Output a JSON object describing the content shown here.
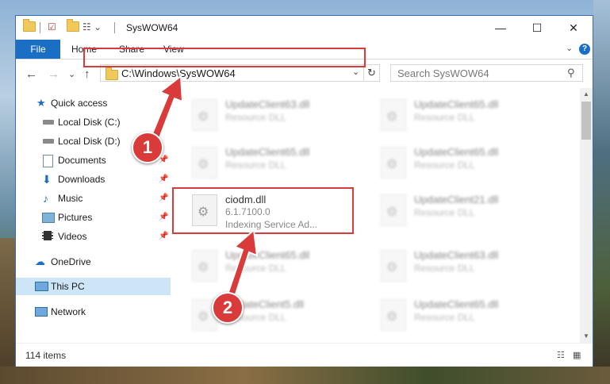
{
  "window": {
    "title": "SysWOW64",
    "controls": {
      "minimize": "—",
      "maximize": "☐",
      "close": "✕"
    }
  },
  "ribbon": {
    "tabs": [
      "File",
      "Home",
      "Share",
      "View"
    ],
    "help": "?",
    "expand": "⌄"
  },
  "nav": {
    "back": "←",
    "forward": "→",
    "recent": "⌄",
    "up": "↑",
    "address": "C:\\Windows\\SysWOW64",
    "address_dropdown": "⌄",
    "refresh": "↻",
    "search_placeholder": "Search SysWOW64"
  },
  "sidebar": {
    "items": [
      {
        "label": "Quick access",
        "icon": "star-icon",
        "pinned": false
      },
      {
        "label": "Local Disk (C:)",
        "icon": "drive-icon",
        "pinned": false
      },
      {
        "label": "Local Disk (D:)",
        "icon": "drive-icon",
        "pinned": false
      },
      {
        "label": "Documents",
        "icon": "documents-icon",
        "pinned": true
      },
      {
        "label": "Downloads",
        "icon": "downloads-icon",
        "pinned": true
      },
      {
        "label": "Music",
        "icon": "music-icon",
        "pinned": true
      },
      {
        "label": "Pictures",
        "icon": "pictures-icon",
        "pinned": true
      },
      {
        "label": "Videos",
        "icon": "videos-icon",
        "pinned": true
      },
      {
        "label": "OneDrive",
        "icon": "cloud-icon",
        "pinned": false
      },
      {
        "label": "This PC",
        "icon": "computer-icon",
        "pinned": false,
        "selected": true
      },
      {
        "label": "Network",
        "icon": "network-icon",
        "pinned": false
      }
    ]
  },
  "files": [
    {
      "name": "UpdateClient63.dll",
      "type": "Resource DLL",
      "blurred": true
    },
    {
      "name": "UpdateClient65.dll",
      "type": "Resource DLL",
      "blurred": true
    },
    {
      "name": "UpdateClient65.dll",
      "type": "Resource DLL",
      "blurred": true
    },
    {
      "name": "UpdateClient65.dll",
      "type": "Resource DLL",
      "blurred": true
    },
    {
      "name": "ciodm.dll",
      "version": "6.1.7100.0",
      "type": "Indexing Service Ad...",
      "blurred": false
    },
    {
      "name": "UpdateClient21.dll",
      "type": "Resource DLL",
      "blurred": true
    },
    {
      "name": "UpdateClient65.dll",
      "type": "Resource DLL",
      "blurred": true
    },
    {
      "name": "UpdateClient63.dll",
      "type": "Resource DLL",
      "blurred": true
    },
    {
      "name": "UpdateClient5.dll",
      "type": "Resource DLL",
      "blurred": true
    },
    {
      "name": "UpdateClient65.dll",
      "type": "Resource DLL",
      "blurred": true
    }
  ],
  "status": {
    "count": "114 items"
  },
  "annotations": {
    "step1": "1",
    "step2": "2"
  },
  "colors": {
    "accent": "#1a6fc4",
    "highlight": "#d93a3a",
    "selected": "#cde6f7"
  }
}
